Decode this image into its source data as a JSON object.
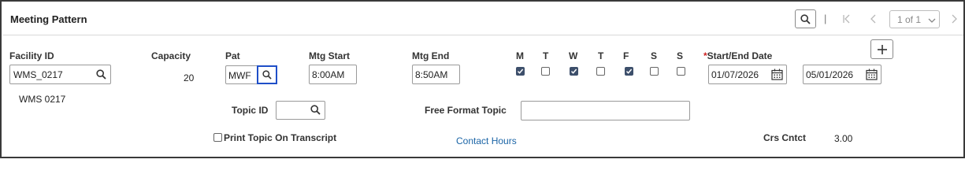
{
  "panel": {
    "title": "Meeting Pattern"
  },
  "pager": {
    "separator": "|",
    "page_select": "1 of 1"
  },
  "labels": {
    "facility_id": "Facility ID",
    "capacity": "Capacity",
    "pat": "Pat",
    "mtg_start": "Mtg Start",
    "mtg_end": "Mtg End",
    "required_marker": "*",
    "start_end_date": "Start/End Date",
    "topic_id": "Topic ID",
    "free_format_topic": "Free Format Topic",
    "print_topic": "Print Topic On Transcript",
    "crs_cntct": "Crs Cntct"
  },
  "fields": {
    "facility_id": "WMS_0217",
    "facility_desc": "WMS  0217",
    "capacity": "20",
    "pat": "MWF",
    "mtg_start": "8:00AM",
    "mtg_end": "8:50AM",
    "start_date": "01/07/2026",
    "end_date": "05/01/2026",
    "topic_id": "",
    "free_format_topic": "",
    "crs_cntct": "3.00"
  },
  "days": [
    {
      "label": "M",
      "checked": true
    },
    {
      "label": "T",
      "checked": false
    },
    {
      "label": "W",
      "checked": true
    },
    {
      "label": "T",
      "checked": false
    },
    {
      "label": "F",
      "checked": true
    },
    {
      "label": "S",
      "checked": false
    },
    {
      "label": "S",
      "checked": false
    }
  ],
  "print_topic_checked": false,
  "links": {
    "contact_hours": "Contact Hours"
  },
  "colors": {
    "accent_focus": "#1f4fc8",
    "checkbox_checked": "#3d4f6b",
    "link": "#1a64a6",
    "border": "#3a3a3a"
  }
}
